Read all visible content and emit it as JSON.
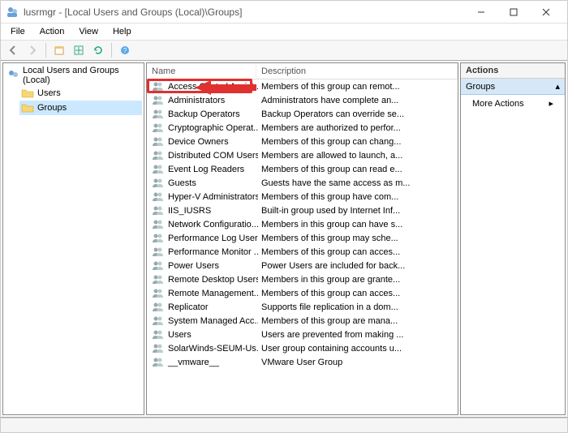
{
  "window": {
    "title": "lusrmgr - [Local Users and Groups (Local)\\Groups]"
  },
  "menu": {
    "file": "File",
    "action": "Action",
    "view": "View",
    "help": "Help"
  },
  "tree": {
    "root": "Local Users and Groups (Local)",
    "users": "Users",
    "groups": "Groups"
  },
  "columns": {
    "name": "Name",
    "description": "Description"
  },
  "groups": [
    {
      "name": "Access Control Assist...",
      "desc": "Members of this group can remot..."
    },
    {
      "name": "Administrators",
      "desc": "Administrators have complete an..."
    },
    {
      "name": "Backup Operators",
      "desc": "Backup Operators can override se..."
    },
    {
      "name": "Cryptographic Operat...",
      "desc": "Members are authorized to perfor..."
    },
    {
      "name": "Device Owners",
      "desc": "Members of this group can chang..."
    },
    {
      "name": "Distributed COM Users",
      "desc": "Members are allowed to launch, a..."
    },
    {
      "name": "Event Log Readers",
      "desc": "Members of this group can read e..."
    },
    {
      "name": "Guests",
      "desc": "Guests have the same access as m..."
    },
    {
      "name": "Hyper-V Administrators",
      "desc": "Members of this group have com..."
    },
    {
      "name": "IIS_IUSRS",
      "desc": "Built-in group used by Internet Inf..."
    },
    {
      "name": "Network Configuratio...",
      "desc": "Members in this group can have s..."
    },
    {
      "name": "Performance Log Users",
      "desc": "Members of this group may sche..."
    },
    {
      "name": "Performance Monitor ...",
      "desc": "Members of this group can acces..."
    },
    {
      "name": "Power Users",
      "desc": "Power Users are included for back..."
    },
    {
      "name": "Remote Desktop Users",
      "desc": "Members in this group are grante..."
    },
    {
      "name": "Remote Management...",
      "desc": "Members of this group can acces..."
    },
    {
      "name": "Replicator",
      "desc": "Supports file replication in a dom..."
    },
    {
      "name": "System Managed Acc...",
      "desc": "Members of this group are mana..."
    },
    {
      "name": "Users",
      "desc": "Users are prevented from making ..."
    },
    {
      "name": "SolarWinds-SEUM-Us...",
      "desc": "User group containing accounts u..."
    },
    {
      "name": "__vmware__",
      "desc": "VMware User Group"
    }
  ],
  "actions": {
    "header": "Actions",
    "groups_label": "Groups",
    "more_actions": "More Actions"
  }
}
